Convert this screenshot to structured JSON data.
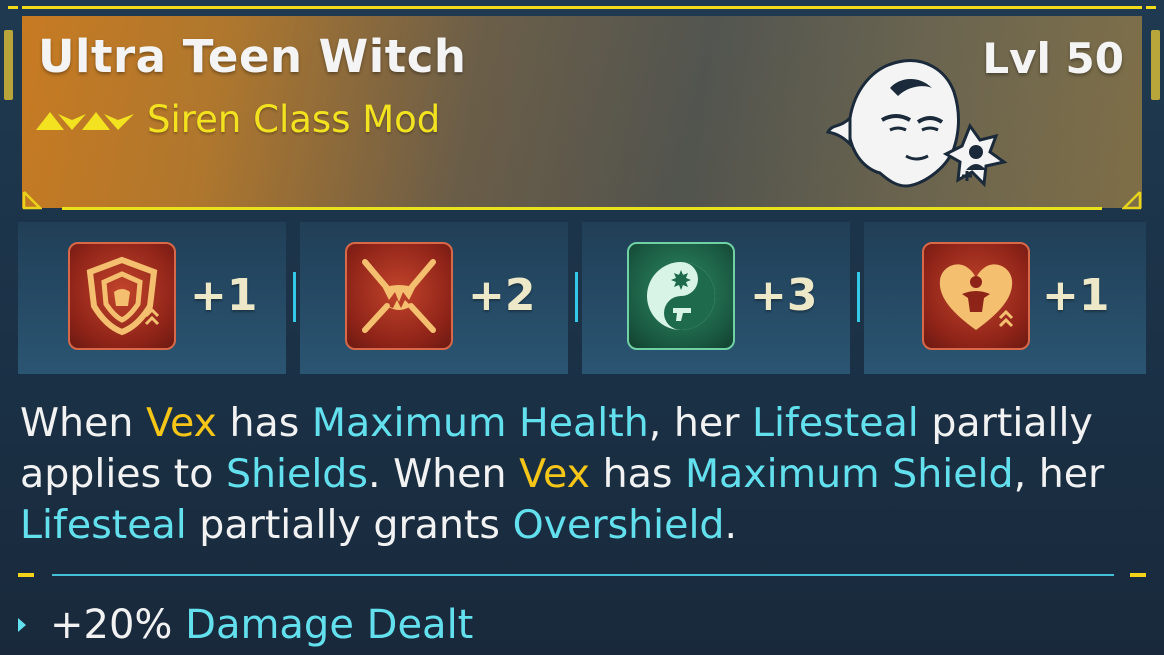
{
  "item": {
    "title": "Ultra Teen Witch",
    "level": "Lvl 50",
    "subtitle": "Siren Class Mod"
  },
  "skills": [
    {
      "bonus": "+1",
      "icon": "shield-upgrade-icon",
      "color": "red"
    },
    {
      "bonus": "+2",
      "icon": "fanged-maw-icon",
      "color": "red"
    },
    {
      "bonus": "+3",
      "icon": "yin-yang-pistol-icon",
      "color": "green"
    },
    {
      "bonus": "+1",
      "icon": "heart-figure-upgrade-icon",
      "color": "red"
    }
  ],
  "description": {
    "s1": "When ",
    "s2": "Vex",
    "s3": " has ",
    "s4": "Maximum Health",
    "s5": ", her ",
    "s6": "Lifesteal",
    "s7": " partially applies to ",
    "s8": "Shields",
    "s9": ". When ",
    "s10": "Vex",
    "s11": " has ",
    "s12": "Maximum Shield",
    "s13": ", her ",
    "s14": "Lifesteal",
    "s15": " partially grants ",
    "s16": "Overshield",
    "s17": "."
  },
  "stat": {
    "prefix": "+20% ",
    "keyword": "Damage Dealt"
  },
  "colors": {
    "accent_yellow": "#f2dc1a",
    "keyword_yellow": "#f5c518",
    "keyword_cyan": "#63e0ee",
    "header_orange": "#d6801e",
    "panel_blue": "#1f3a50"
  }
}
